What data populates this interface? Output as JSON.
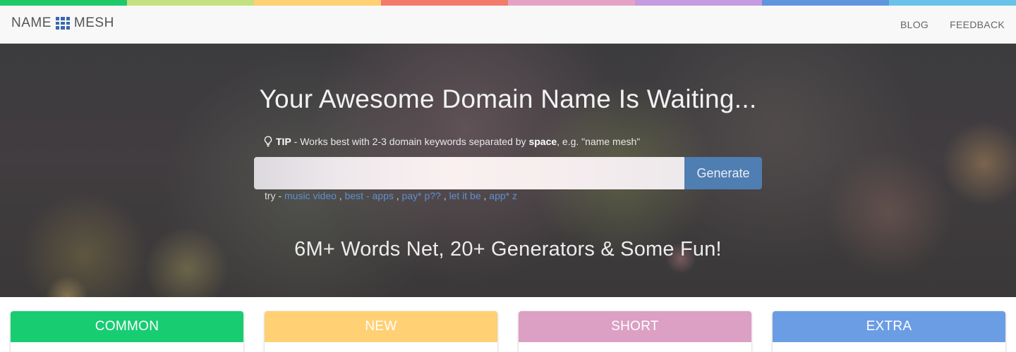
{
  "color_strip": [
    "#1ec96a",
    "#c4e17f",
    "#ffd074",
    "#f27b6b",
    "#e4a3c4",
    "#c59ae0",
    "#5e95dd",
    "#6ac2e8"
  ],
  "navbar": {
    "logo_left": "NAME",
    "logo_right": "MESH",
    "logo_icon": "grid-icon",
    "links": [
      {
        "label": "BLOG"
      },
      {
        "label": "FEEDBACK"
      }
    ]
  },
  "hero": {
    "title": "Your Awesome Domain Name Is Waiting...",
    "tip": {
      "icon": "lightbulb-icon",
      "label": "TIP",
      "text_before": " - Works best with 2-3 domain keywords separated by ",
      "bold_word": "space",
      "text_after": ", e.g. \"name mesh\""
    },
    "search": {
      "value": "",
      "placeholder": "",
      "button_label": "Generate"
    },
    "try": {
      "prefix": "try -",
      "examples": [
        "music video",
        "best - apps",
        "pay* p??",
        "let it be",
        "app* z"
      ]
    },
    "subtitle": "6M+ Words Net, 20+ Generators & Some Fun!"
  },
  "cards": [
    {
      "label": "COMMON",
      "color": "#18cc72"
    },
    {
      "label": "NEW",
      "color": "#ffd074"
    },
    {
      "label": "SHORT",
      "color": "#dba0c4"
    },
    {
      "label": "EXTRA",
      "color": "#6b9de4"
    }
  ]
}
